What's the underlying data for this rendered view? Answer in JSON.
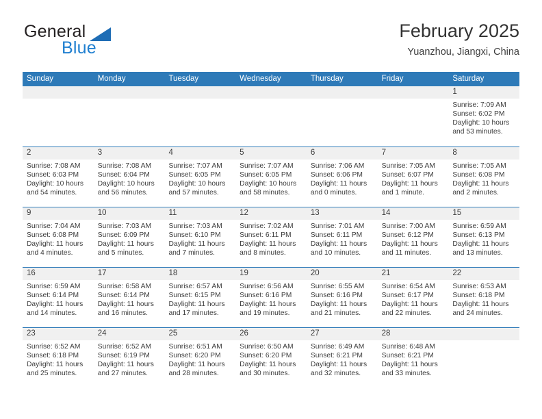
{
  "brand": {
    "name_top": "General",
    "name_bottom": "Blue",
    "triangle_color": "#1f6db5",
    "blue_color": "#1f7fd0"
  },
  "header": {
    "title": "February 2025",
    "subtitle": "Yuanzhou, Jiangxi, China"
  },
  "colors": {
    "header_blue": "#2e7ab8",
    "daynum_band": "#f0f0f0",
    "text": "#3c3c3c"
  },
  "weekdays": [
    "Sunday",
    "Monday",
    "Tuesday",
    "Wednesday",
    "Thursday",
    "Friday",
    "Saturday"
  ],
  "weeks": [
    [
      {
        "day": "",
        "sunrise": "",
        "sunset": "",
        "daylight": ""
      },
      {
        "day": "",
        "sunrise": "",
        "sunset": "",
        "daylight": ""
      },
      {
        "day": "",
        "sunrise": "",
        "sunset": "",
        "daylight": ""
      },
      {
        "day": "",
        "sunrise": "",
        "sunset": "",
        "daylight": ""
      },
      {
        "day": "",
        "sunrise": "",
        "sunset": "",
        "daylight": ""
      },
      {
        "day": "",
        "sunrise": "",
        "sunset": "",
        "daylight": ""
      },
      {
        "day": "1",
        "sunrise": "Sunrise: 7:09 AM",
        "sunset": "Sunset: 6:02 PM",
        "daylight": "Daylight: 10 hours and 53 minutes."
      }
    ],
    [
      {
        "day": "2",
        "sunrise": "Sunrise: 7:08 AM",
        "sunset": "Sunset: 6:03 PM",
        "daylight": "Daylight: 10 hours and 54 minutes."
      },
      {
        "day": "3",
        "sunrise": "Sunrise: 7:08 AM",
        "sunset": "Sunset: 6:04 PM",
        "daylight": "Daylight: 10 hours and 56 minutes."
      },
      {
        "day": "4",
        "sunrise": "Sunrise: 7:07 AM",
        "sunset": "Sunset: 6:05 PM",
        "daylight": "Daylight: 10 hours and 57 minutes."
      },
      {
        "day": "5",
        "sunrise": "Sunrise: 7:07 AM",
        "sunset": "Sunset: 6:05 PM",
        "daylight": "Daylight: 10 hours and 58 minutes."
      },
      {
        "day": "6",
        "sunrise": "Sunrise: 7:06 AM",
        "sunset": "Sunset: 6:06 PM",
        "daylight": "Daylight: 11 hours and 0 minutes."
      },
      {
        "day": "7",
        "sunrise": "Sunrise: 7:05 AM",
        "sunset": "Sunset: 6:07 PM",
        "daylight": "Daylight: 11 hours and 1 minute."
      },
      {
        "day": "8",
        "sunrise": "Sunrise: 7:05 AM",
        "sunset": "Sunset: 6:08 PM",
        "daylight": "Daylight: 11 hours and 2 minutes."
      }
    ],
    [
      {
        "day": "9",
        "sunrise": "Sunrise: 7:04 AM",
        "sunset": "Sunset: 6:08 PM",
        "daylight": "Daylight: 11 hours and 4 minutes."
      },
      {
        "day": "10",
        "sunrise": "Sunrise: 7:03 AM",
        "sunset": "Sunset: 6:09 PM",
        "daylight": "Daylight: 11 hours and 5 minutes."
      },
      {
        "day": "11",
        "sunrise": "Sunrise: 7:03 AM",
        "sunset": "Sunset: 6:10 PM",
        "daylight": "Daylight: 11 hours and 7 minutes."
      },
      {
        "day": "12",
        "sunrise": "Sunrise: 7:02 AM",
        "sunset": "Sunset: 6:11 PM",
        "daylight": "Daylight: 11 hours and 8 minutes."
      },
      {
        "day": "13",
        "sunrise": "Sunrise: 7:01 AM",
        "sunset": "Sunset: 6:11 PM",
        "daylight": "Daylight: 11 hours and 10 minutes."
      },
      {
        "day": "14",
        "sunrise": "Sunrise: 7:00 AM",
        "sunset": "Sunset: 6:12 PM",
        "daylight": "Daylight: 11 hours and 11 minutes."
      },
      {
        "day": "15",
        "sunrise": "Sunrise: 6:59 AM",
        "sunset": "Sunset: 6:13 PM",
        "daylight": "Daylight: 11 hours and 13 minutes."
      }
    ],
    [
      {
        "day": "16",
        "sunrise": "Sunrise: 6:59 AM",
        "sunset": "Sunset: 6:14 PM",
        "daylight": "Daylight: 11 hours and 14 minutes."
      },
      {
        "day": "17",
        "sunrise": "Sunrise: 6:58 AM",
        "sunset": "Sunset: 6:14 PM",
        "daylight": "Daylight: 11 hours and 16 minutes."
      },
      {
        "day": "18",
        "sunrise": "Sunrise: 6:57 AM",
        "sunset": "Sunset: 6:15 PM",
        "daylight": "Daylight: 11 hours and 17 minutes."
      },
      {
        "day": "19",
        "sunrise": "Sunrise: 6:56 AM",
        "sunset": "Sunset: 6:16 PM",
        "daylight": "Daylight: 11 hours and 19 minutes."
      },
      {
        "day": "20",
        "sunrise": "Sunrise: 6:55 AM",
        "sunset": "Sunset: 6:16 PM",
        "daylight": "Daylight: 11 hours and 21 minutes."
      },
      {
        "day": "21",
        "sunrise": "Sunrise: 6:54 AM",
        "sunset": "Sunset: 6:17 PM",
        "daylight": "Daylight: 11 hours and 22 minutes."
      },
      {
        "day": "22",
        "sunrise": "Sunrise: 6:53 AM",
        "sunset": "Sunset: 6:18 PM",
        "daylight": "Daylight: 11 hours and 24 minutes."
      }
    ],
    [
      {
        "day": "23",
        "sunrise": "Sunrise: 6:52 AM",
        "sunset": "Sunset: 6:18 PM",
        "daylight": "Daylight: 11 hours and 25 minutes."
      },
      {
        "day": "24",
        "sunrise": "Sunrise: 6:52 AM",
        "sunset": "Sunset: 6:19 PM",
        "daylight": "Daylight: 11 hours and 27 minutes."
      },
      {
        "day": "25",
        "sunrise": "Sunrise: 6:51 AM",
        "sunset": "Sunset: 6:20 PM",
        "daylight": "Daylight: 11 hours and 28 minutes."
      },
      {
        "day": "26",
        "sunrise": "Sunrise: 6:50 AM",
        "sunset": "Sunset: 6:20 PM",
        "daylight": "Daylight: 11 hours and 30 minutes."
      },
      {
        "day": "27",
        "sunrise": "Sunrise: 6:49 AM",
        "sunset": "Sunset: 6:21 PM",
        "daylight": "Daylight: 11 hours and 32 minutes."
      },
      {
        "day": "28",
        "sunrise": "Sunrise: 6:48 AM",
        "sunset": "Sunset: 6:21 PM",
        "daylight": "Daylight: 11 hours and 33 minutes."
      },
      {
        "day": "",
        "sunrise": "",
        "sunset": "",
        "daylight": ""
      }
    ]
  ]
}
